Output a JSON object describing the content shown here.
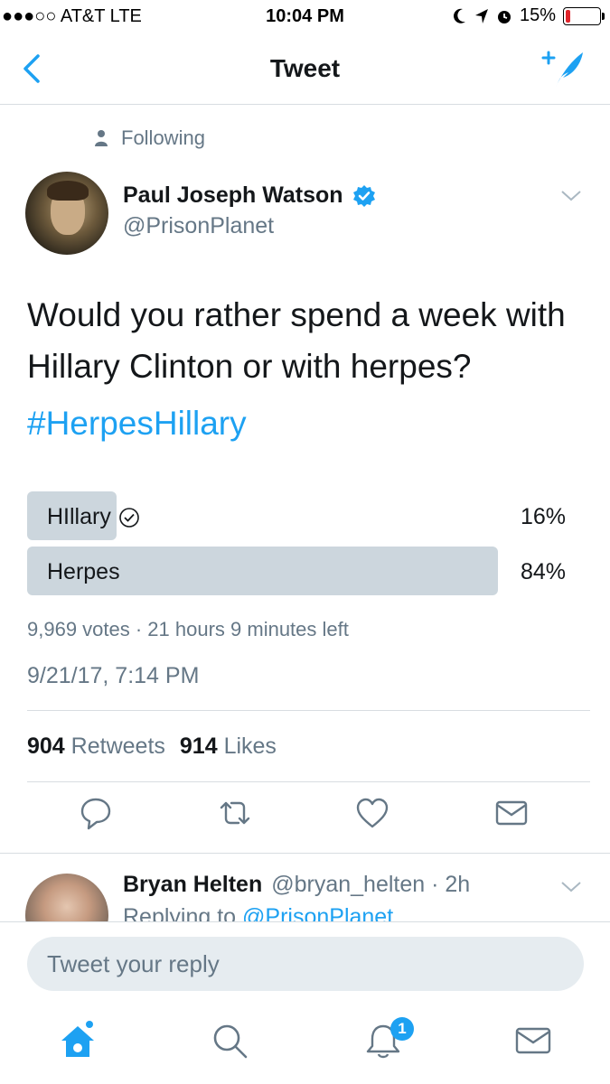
{
  "status_bar": {
    "carrier": "●●●○○ AT&T  LTE",
    "time": "10:04 PM",
    "battery": "15%",
    "battery_level": 0.15
  },
  "nav": {
    "title": "Tweet",
    "back_icon": "chevron-left-icon",
    "compose_icon": "compose-tweet-icon",
    "accent_color": "#1da1f2"
  },
  "tweet": {
    "context": "Following",
    "author_name": "Paul Joseph Watson",
    "author_handle": "@PrisonPlanet",
    "verified": true,
    "text": "Would you rather spend a week with Hillary Clinton or with herpes?",
    "hashtag": "#HerpesHillary",
    "poll": {
      "options": [
        {
          "label": "HIllary",
          "percent_label": "16%",
          "percent": 16,
          "selected": true
        },
        {
          "label": "Herpes",
          "percent_label": "84%",
          "percent": 84,
          "selected": false
        }
      ],
      "meta": "9,969 votes · 21 hours 9 minutes left"
    },
    "timestamp": "9/21/17, 7:14 PM",
    "stats": {
      "retweets_count": "904",
      "retweets_label": "Retweets",
      "likes_count": "914",
      "likes_label": "Likes"
    }
  },
  "reply": {
    "name": "Bryan Helten",
    "handle_time": "@bryan_helten · 2h",
    "replying_prefix": "Replying to",
    "replying_to": "@PrisonPlanet"
  },
  "reply_box": {
    "placeholder": "Tweet your reply"
  },
  "tabbar": {
    "notification_count": "1"
  }
}
